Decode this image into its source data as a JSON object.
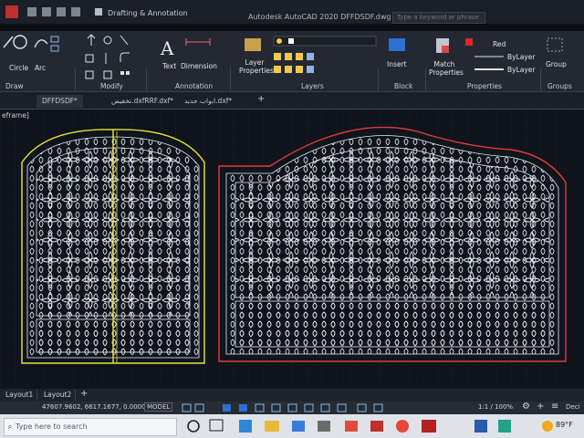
{
  "titlebar": {
    "workspace": "Drafting & Annotation",
    "app_title": "Autodesk AutoCAD 2020   DFFDSDF.dwg",
    "search_placeholder": "Type a keyword or phrase"
  },
  "ribbon": {
    "draw_tools": {
      "circle": "Circle",
      "arc": "Arc"
    },
    "annotation_tools": {
      "text": "Text",
      "dimension": "Dimension"
    },
    "layer_properties": "Layer Properties",
    "insert": "Insert",
    "match_properties": "Match Properties",
    "color_value": "Red",
    "linetype_value": "ByLayer",
    "lineweight_value": "ByLayer",
    "group": "Group",
    "panels": {
      "draw": "Draw",
      "modify": "Modify",
      "annotation": "Annotation",
      "layers": "Layers",
      "block": "Block",
      "properties": "Properties",
      "groups": "Groups"
    }
  },
  "doc_tabs": [
    {
      "label": "DFFDSDF*"
    },
    {
      "label": "تخفيض.dxfRRF.dxf*"
    },
    {
      "label": "ابواب جديد.dxf*"
    }
  ],
  "viewport_label": "eframe]",
  "layout_tabs": {
    "layout1": "Layout1",
    "layout2": "Layout2"
  },
  "status": {
    "coordinates": "47607.9602, 6617.1677, 0.0000",
    "model": "MODEL",
    "scale": "1:1 / 100%",
    "decimal": "Deci"
  },
  "taskbar": {
    "search_placeholder": "Type here to search",
    "temperature": "89°F"
  },
  "colors": {
    "gate_left_outline": "#e9e43a",
    "gate_right_outline": "#e23b3b",
    "pattern": "#e9edf3",
    "red_swatch": "#e52424"
  }
}
